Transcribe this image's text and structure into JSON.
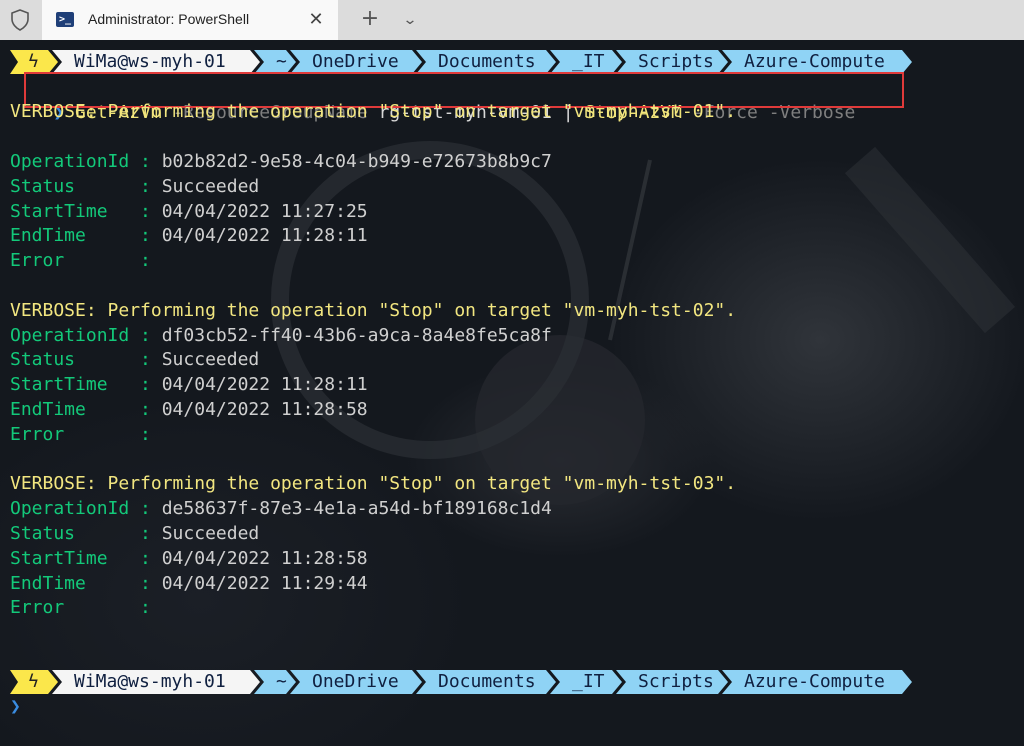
{
  "window": {
    "tab_title": "Administrator: PowerShell",
    "tab_icon": "powershell-icon",
    "close_glyph": "✕",
    "new_tab_glyph": "+",
    "dropdown_glyph": "⌄"
  },
  "prompt": {
    "segments": [
      "ϟ",
      "WiMa@ws-myh-01",
      "~",
      "OneDrive",
      "Documents",
      "_IT",
      "Scripts",
      "Azure-Compute"
    ],
    "caret": "❯"
  },
  "command": {
    "cmdlet1": "Get-AzVm",
    "param1": "-ResourceGroupName",
    "arg1": "rg-tst-myh-vm-01",
    "pipe": "|",
    "cmdlet2": "Stop-AzVM",
    "param2": "-Force",
    "param3": "-Verbose"
  },
  "output": {
    "verbose_lines": [
      "VERBOSE: Performing the operation \"Stop\" on target \"vm-myh-tst-01\".",
      "VERBOSE: Performing the operation \"Stop\" on target \"vm-myh-tst-02\".",
      "VERBOSE: Performing the operation \"Stop\" on target \"vm-myh-tst-03\"."
    ],
    "labels": {
      "operation_id": "OperationId : ",
      "status": "Status      : ",
      "start_time": "StartTime   : ",
      "end_time": "EndTime     : ",
      "error": "Error       :"
    },
    "results": [
      {
        "operation_id": "b02b82d2-9e58-4c04-b949-e72673b8b9c7",
        "status": "Succeeded",
        "start_time": "04/04/2022 11:27:25",
        "end_time": "04/04/2022 11:28:11",
        "error": ""
      },
      {
        "operation_id": "df03cb52-ff40-43b6-a9ca-8a4e8fe5ca8f",
        "status": "Succeeded",
        "start_time": "04/04/2022 11:28:11",
        "end_time": "04/04/2022 11:28:58",
        "error": ""
      },
      {
        "operation_id": "de58637f-87e3-4e1a-a54d-bf189168c1d4",
        "status": "Succeeded",
        "start_time": "04/04/2022 11:28:58",
        "end_time": "04/04/2022 11:29:44",
        "error": ""
      }
    ]
  },
  "colors": {
    "accent_red": "#e03a3a",
    "prompt_yellow": "#fbe74b",
    "prompt_white": "#f5f5f5",
    "prompt_blue": "#8fd3f5",
    "key_green": "#13c97a",
    "verbose_yellow": "#f2e680",
    "caret_blue": "#3a8ce0"
  }
}
